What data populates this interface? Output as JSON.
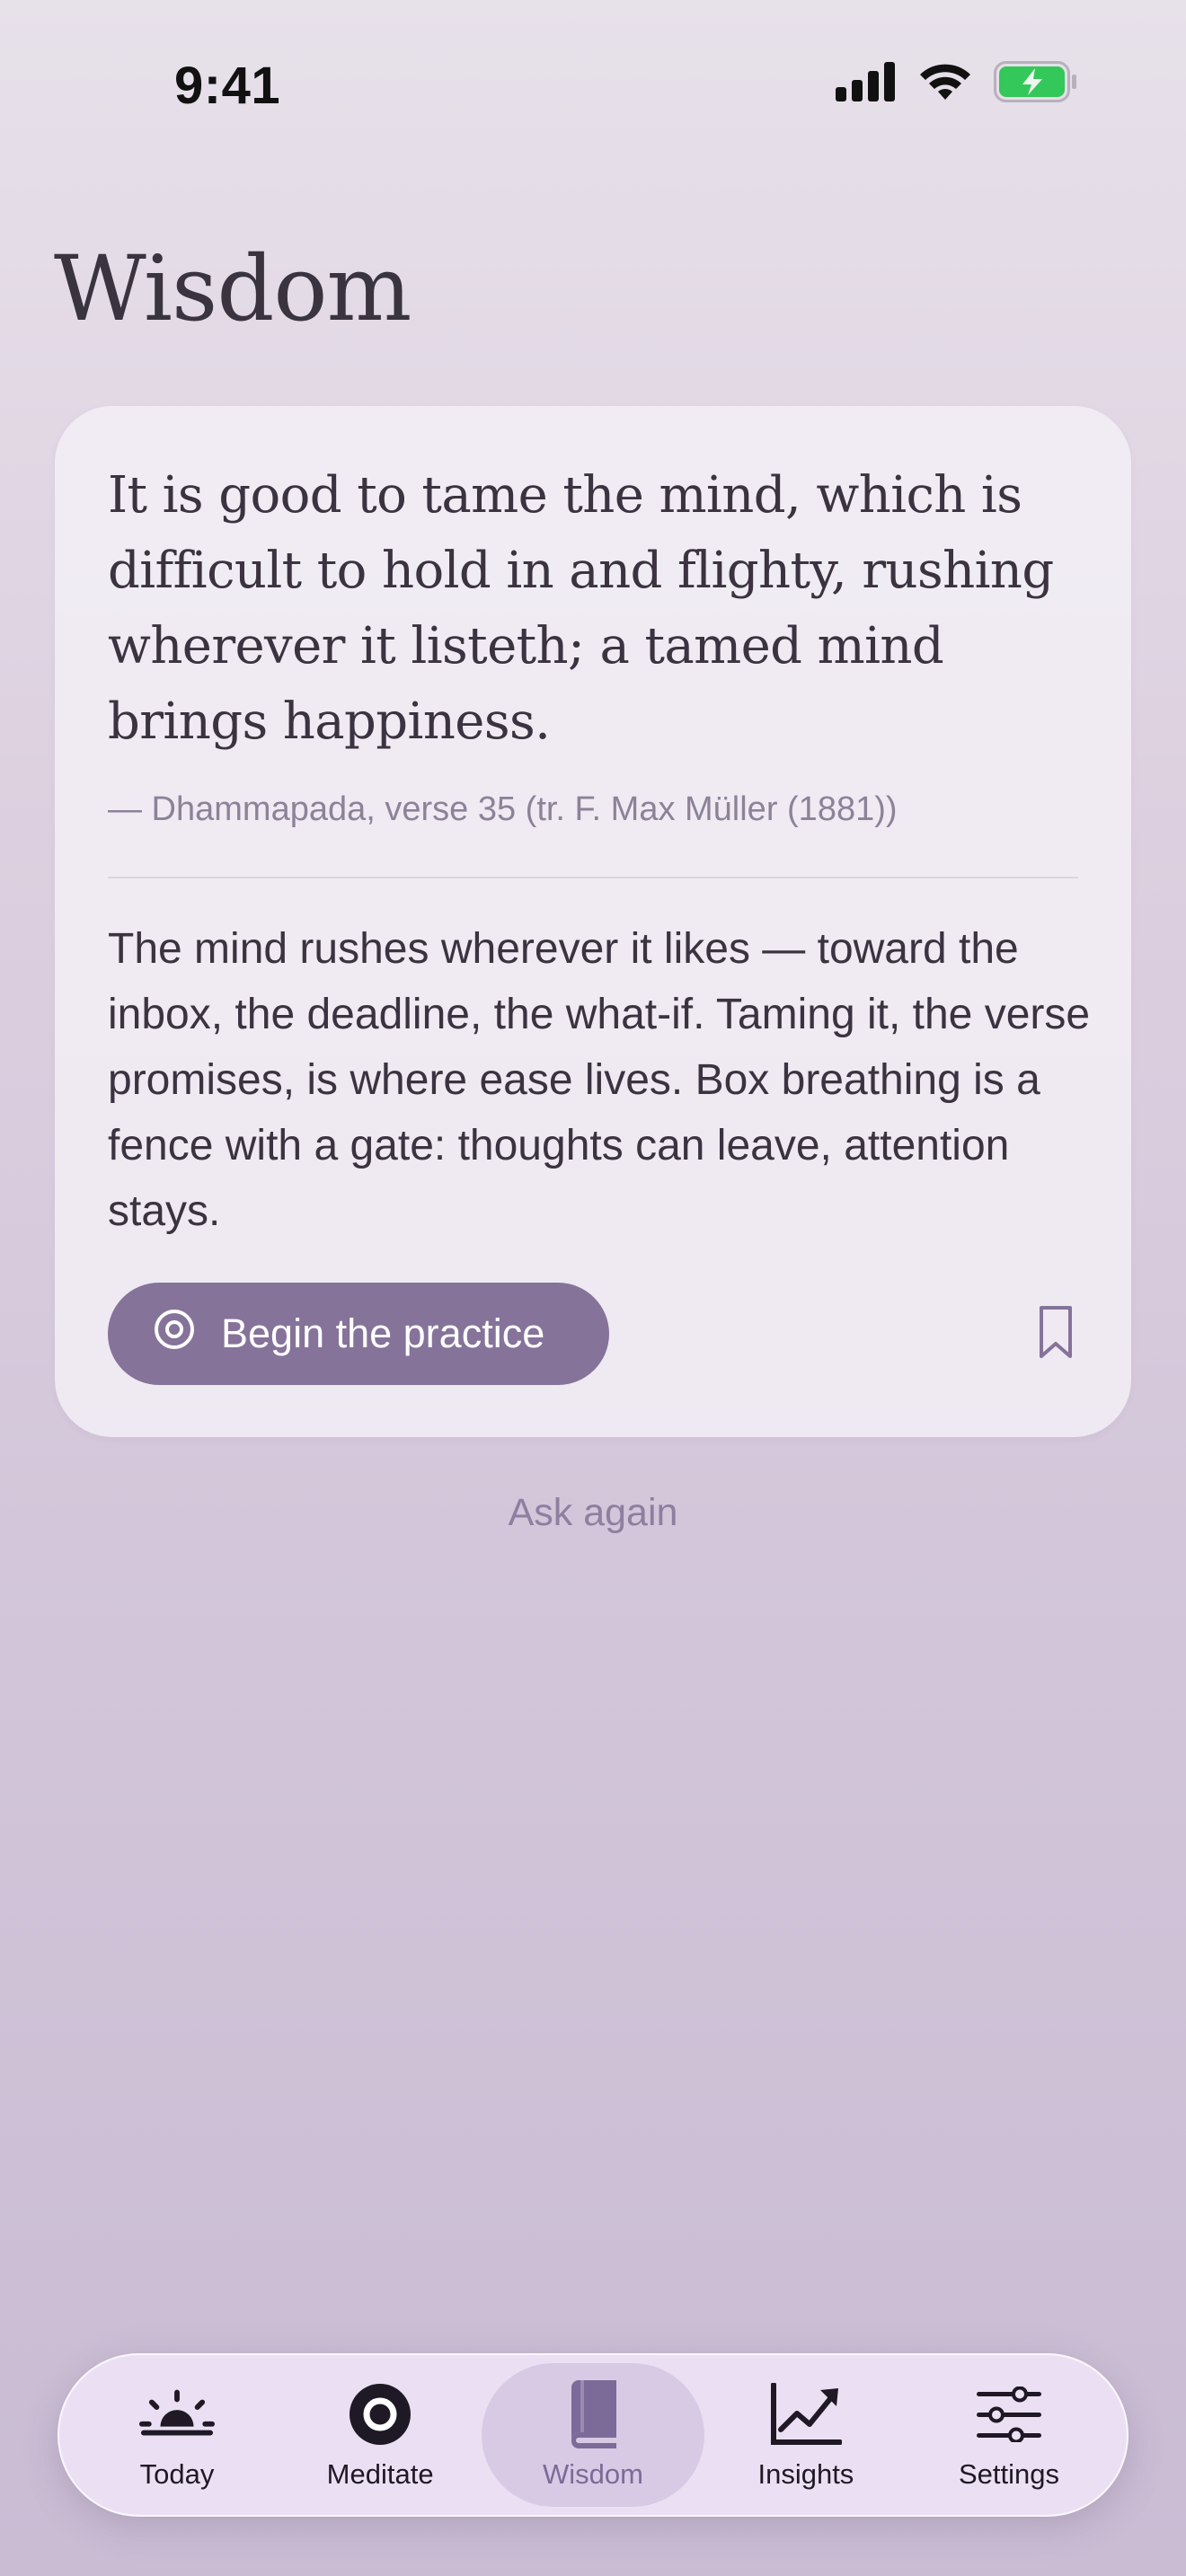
{
  "status_bar": {
    "time": "9:41"
  },
  "page": {
    "title": "Wisdom"
  },
  "card": {
    "quote": "It is good to tame the mind, which is difficult to hold in and flighty, rushing wherever it listeth; a tamed mind brings happiness.",
    "attribution": "— Dhammapada, verse 35 (tr. F. Max Müller (1881))",
    "reflection": "The mind rushes wherever it likes — toward the inbox, the deadline, the what-if. Taming it, the verse promises, is where ease lives. Box breathing is a fence with a gate: thoughts can leave, attention stays.",
    "begin_button": {
      "label": "Begin the practice",
      "icon": "target-icon"
    },
    "bookmark_icon": "bookmark-icon"
  },
  "ask_again": "Ask again",
  "tab_bar": {
    "active": "Wisdom",
    "tabs": [
      {
        "label": "Today",
        "icon": "sunrise-icon"
      },
      {
        "label": "Meditate",
        "icon": "circle-icon"
      },
      {
        "label": "Wisdom",
        "icon": "book-icon"
      },
      {
        "label": "Insights",
        "icon": "chart-icon"
      },
      {
        "label": "Settings",
        "icon": "sliders-icon"
      }
    ]
  },
  "colors": {
    "accent": "#85739a",
    "active_tab_label": "#7c6b98",
    "battery_green": "#34c759"
  }
}
